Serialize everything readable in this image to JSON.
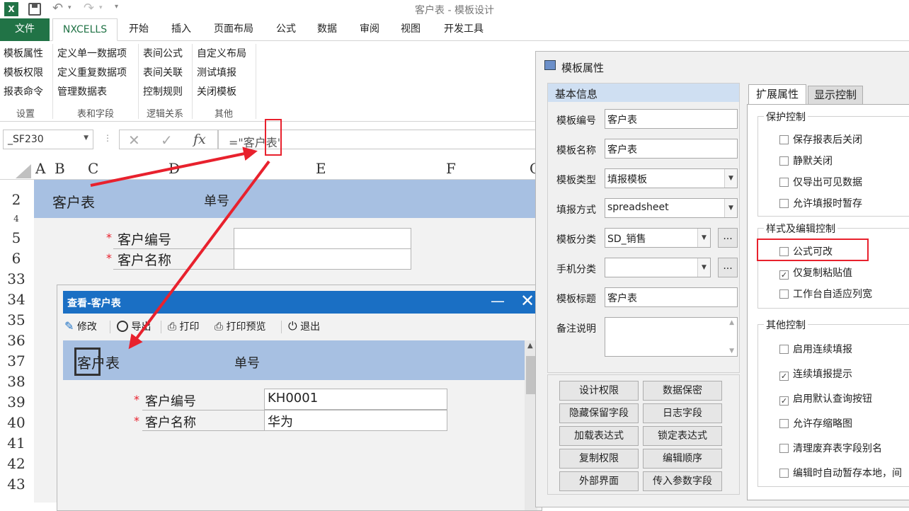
{
  "window": {
    "title": "客户表 - 模板设计"
  },
  "qat": {
    "save_icon": "save-icon",
    "undo_icon": "undo-icon",
    "redo_icon": "redo-icon"
  },
  "ribbon_tabs": [
    "文件",
    "NXCELLS",
    "开始",
    "插入",
    "页面布局",
    "公式",
    "数据",
    "审阅",
    "视图",
    "开发工具"
  ],
  "ribbon": {
    "groups": [
      {
        "label": "设置",
        "items": [
          "模板属性",
          "模板权限",
          "报表命令"
        ]
      },
      {
        "label": "表和字段",
        "items": [
          "定义单一数据项",
          "定义重复数据项",
          "管理数据表"
        ]
      },
      {
        "label": "逻辑关系",
        "items": [
          "表间公式",
          "表间关联",
          "控制规则"
        ]
      },
      {
        "label": "其他",
        "items": [
          "自定义布局",
          "测试填报",
          "关闭模板"
        ]
      }
    ]
  },
  "formula_bar": {
    "name_box": "_SF230",
    "fx": "fx",
    "formula": "=\"客户表\""
  },
  "sheet": {
    "columns": [
      "A",
      "B",
      "C",
      "D",
      "E",
      "F",
      "G"
    ],
    "rows": [
      "2",
      "4",
      "5",
      "6",
      "33",
      "34",
      "35",
      "36",
      "37",
      "38",
      "39",
      "40",
      "41",
      "42",
      "43"
    ],
    "title": "客户表",
    "order_label": "单号",
    "required_mark": "*",
    "fields": [
      "客户编号",
      "客户名称"
    ]
  },
  "props_dialog": {
    "title": "模板属性",
    "basic_info": {
      "header": "基本信息",
      "rows": [
        {
          "label": "模板编号",
          "value": "客户表"
        },
        {
          "label": "模板名称",
          "value": "客户表"
        },
        {
          "label": "模板类型",
          "value": "填报模板"
        },
        {
          "label": "填报方式",
          "value": "spreadsheet"
        },
        {
          "label": "模板分类",
          "value": "SD_销售"
        },
        {
          "label": "手机分类",
          "value": ""
        },
        {
          "label": "模板标题",
          "value": "客户表"
        },
        {
          "label": "备注说明",
          "value": ""
        }
      ],
      "ellipsis": "..."
    },
    "buttons": [
      "设计权限",
      "数据保密",
      "隐藏保留字段",
      "日志字段",
      "加载表达式",
      "锁定表达式",
      "复制权限",
      "编辑顺序",
      "外部界面",
      "传入参数字段"
    ],
    "tabs": [
      "扩展属性",
      "显示控制"
    ],
    "protect": {
      "header": "保护控制",
      "items": [
        {
          "label": "保存报表后关闭",
          "checked": false
        },
        {
          "label": "静默关闭",
          "checked": false
        },
        {
          "label": "仅导出可见数据",
          "checked": false
        },
        {
          "label": "允许填报时暂存",
          "checked": false
        }
      ]
    },
    "style": {
      "header": "样式及编辑控制",
      "items": [
        {
          "label": "公式可改",
          "checked": false
        },
        {
          "label": "仅复制粘贴值",
          "checked": true
        },
        {
          "label": "工作台自适应列宽",
          "checked": false
        }
      ]
    },
    "other": {
      "header": "其他控制",
      "items": [
        {
          "label": "启用连续填报",
          "checked": false
        },
        {
          "label": "连续填报提示",
          "checked": true
        },
        {
          "label": "启用默认查询按钮",
          "checked": true
        },
        {
          "label": "允许存缩略图",
          "checked": false
        },
        {
          "label": "清理废弃表字段别名",
          "checked": false
        },
        {
          "label": "编辑时自动暂存本地，间",
          "checked": false
        }
      ]
    }
  },
  "view_dialog": {
    "title": "查看-客户表",
    "toolbar": [
      "修改",
      "导出",
      "打印",
      "打印预览",
      "退出"
    ],
    "form_title": "客户表",
    "order_label": "单号",
    "required_mark": "*",
    "fields": [
      {
        "label": "客户编号",
        "value": "KH0001"
      },
      {
        "label": "客户名称",
        "value": "华为"
      }
    ]
  },
  "colors": {
    "excel_green": "#217346",
    "band_blue": "#a7c0e2",
    "dialog_blue": "#1a6fc4",
    "annotation_red": "#e8212d"
  }
}
